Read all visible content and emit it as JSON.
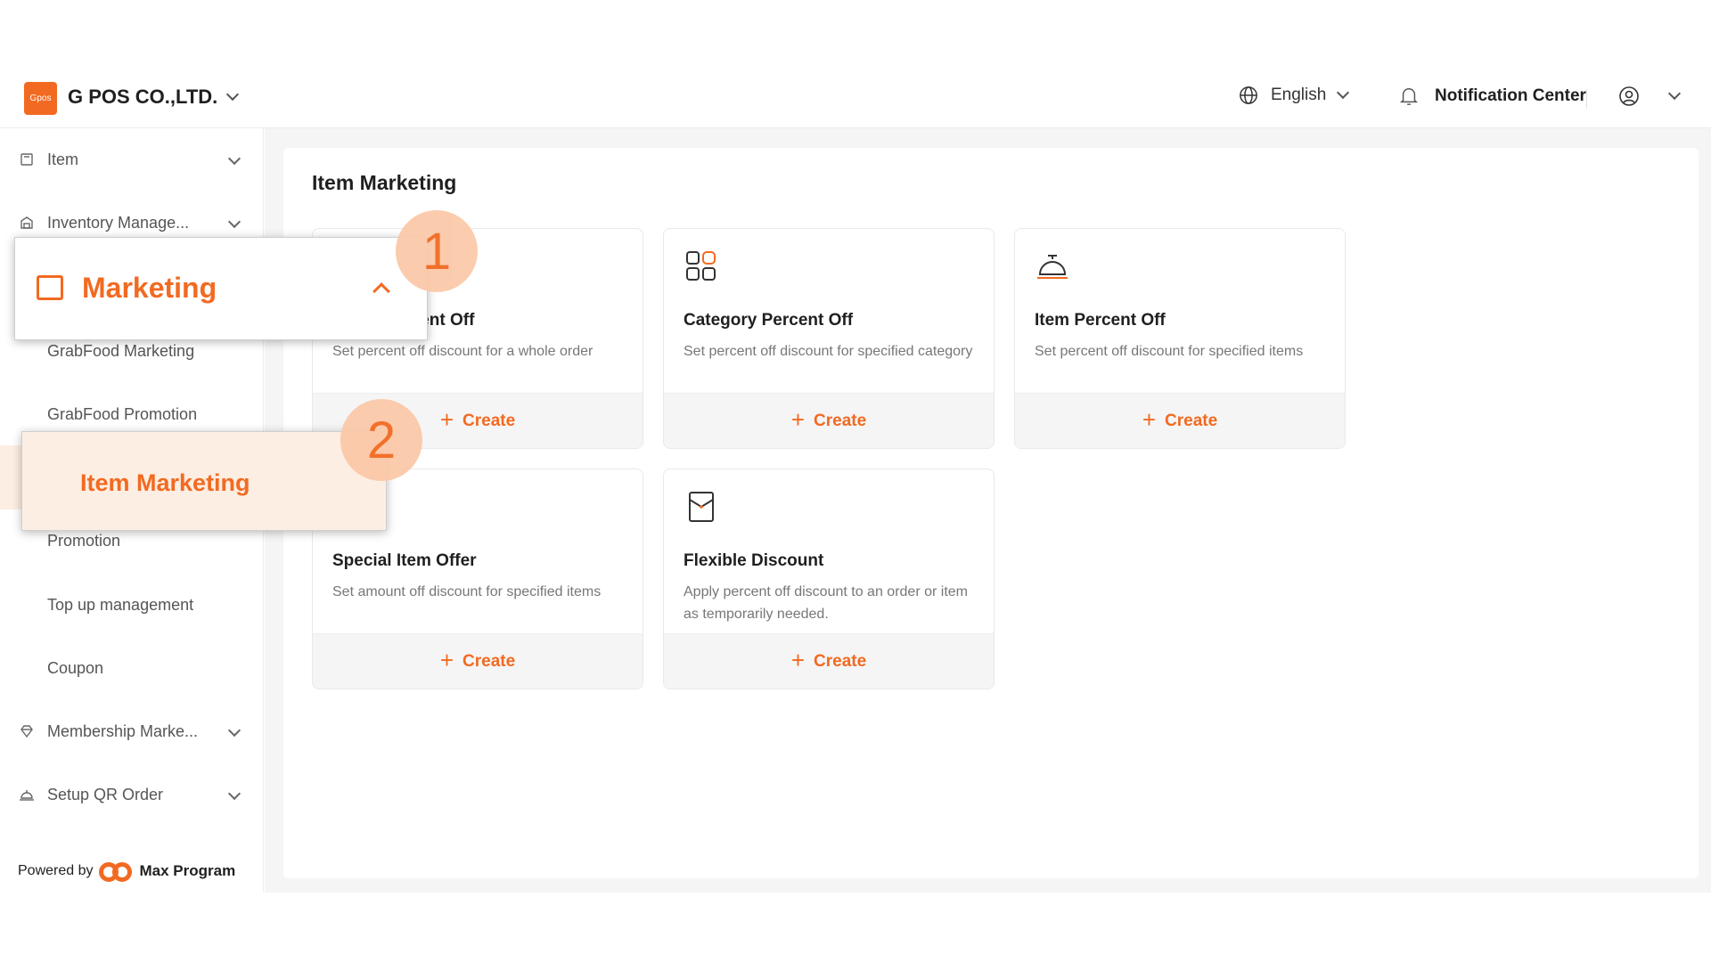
{
  "header": {
    "logo_text": "Gpos",
    "company": "G POS CO.,LTD.",
    "language": "English",
    "notification": "Notification Center"
  },
  "sidebar": {
    "items": [
      {
        "label": "Item",
        "icon": "box-icon"
      },
      {
        "label": "Inventory Manage...",
        "icon": "warehouse-icon"
      },
      {
        "label": "Marketing",
        "icon": "ticket-icon"
      },
      {
        "label": "GrabFood Marketing"
      },
      {
        "label": "GrabFood Promotion"
      },
      {
        "label": "Item Marketing"
      },
      {
        "label": "Promotion"
      },
      {
        "label": "Top up management"
      },
      {
        "label": "Coupon"
      },
      {
        "label": "Membership Marke...",
        "icon": "diamond-icon"
      },
      {
        "label": "Setup QR Order",
        "icon": "bell-service-icon"
      }
    ],
    "powered_by": "Powered by",
    "brand": "Max Program"
  },
  "main": {
    "title": "Item Marketing",
    "create_label": "Create",
    "cards": [
      {
        "title": "Order Percent Off",
        "desc": "Set percent off discount for a whole order"
      },
      {
        "title": "Category Percent Off",
        "desc": "Set percent off discount for specified category"
      },
      {
        "title": "Item Percent Off",
        "desc": "Set percent off discount for specified items"
      },
      {
        "title": "Special Item Offer",
        "desc": "Set amount off discount for specified items"
      },
      {
        "title": "Flexible Discount",
        "desc": "Apply percent off discount to an order or item as temporarily needed."
      }
    ]
  },
  "callouts": {
    "step1": "1",
    "step2": "2",
    "marketing": "Marketing",
    "item_marketing": "Item Marketing"
  },
  "colors": {
    "accent": "#f26a21",
    "highlight": "#fdeee3",
    "badge": "#fbc9a9"
  }
}
